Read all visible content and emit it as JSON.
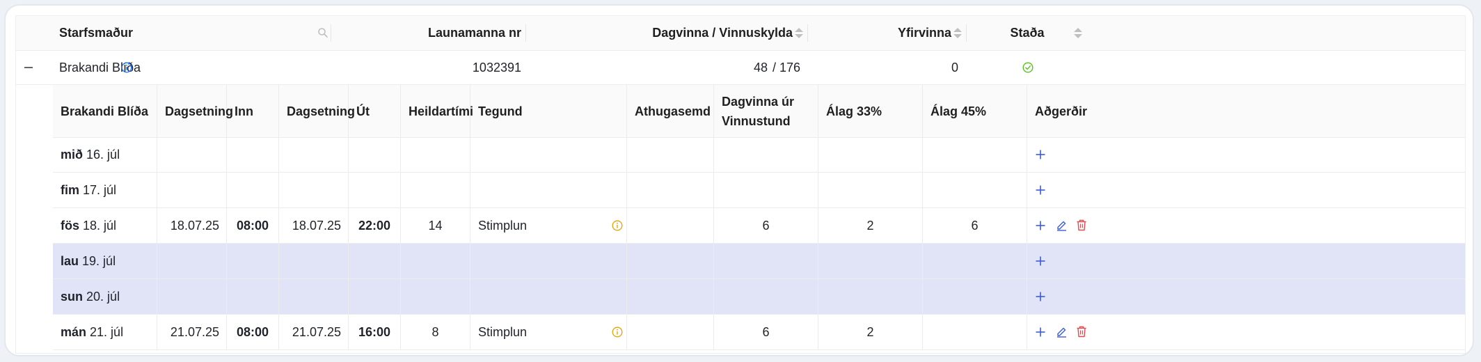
{
  "header": {
    "employee": "Starfsmaður",
    "employee_no": "Launamanna nr",
    "daywork": "Dagvinna / Vinnuskylda",
    "overtime": "Yfirvinna",
    "status": "Staða"
  },
  "employee": {
    "name": "Brakandi Blíða",
    "number": "1032391",
    "daywork": "48",
    "required": "/ 176",
    "overtime": "0"
  },
  "inner_header": {
    "name": "Brakandi Blíða",
    "date_in": "Dagsetning",
    "in": "Inn",
    "date_out": "Dagsetning",
    "out": "Út",
    "total": "Heildartími",
    "type": "Tegund",
    "comment": "Athugasemd",
    "daywork": "Dagvinna úr Vinnustund",
    "alag33": "Álag 33%",
    "alag45": "Álag 45%",
    "actions": "Aðgerðir"
  },
  "rows": [
    {
      "weekday": "mið",
      "date": "16. júl",
      "date_in": "",
      "in": "",
      "date_out": "",
      "out": "",
      "total": "",
      "type": "",
      "comment": "",
      "daywork": "",
      "alag33": "",
      "alag45": ""
    },
    {
      "weekday": "fim",
      "date": "17. júl",
      "date_in": "",
      "in": "",
      "date_out": "",
      "out": "",
      "total": "",
      "type": "",
      "comment": "",
      "daywork": "",
      "alag33": "",
      "alag45": ""
    },
    {
      "weekday": "fös",
      "date": "18. júl",
      "date_in": "18.07.25",
      "in": "08:00",
      "date_out": "18.07.25",
      "out": "22:00",
      "total": "14",
      "type": "Stimplun",
      "comment": "",
      "daywork": "6",
      "alag33": "2",
      "alag45": "6"
    },
    {
      "weekday": "lau",
      "date": "19. júl",
      "date_in": "",
      "in": "",
      "date_out": "",
      "out": "",
      "total": "",
      "type": "",
      "comment": "",
      "daywork": "",
      "alag33": "",
      "alag45": ""
    },
    {
      "weekday": "sun",
      "date": "20. júl",
      "date_in": "",
      "in": "",
      "date_out": "",
      "out": "",
      "total": "",
      "type": "",
      "comment": "",
      "daywork": "",
      "alag33": "",
      "alag45": ""
    },
    {
      "weekday": "mán",
      "date": "21. júl",
      "date_in": "21.07.25",
      "in": "08:00",
      "date_out": "21.07.25",
      "out": "16:00",
      "total": "8",
      "type": "Stimplun",
      "comment": "",
      "daywork": "6",
      "alag33": "2",
      "alag45": ""
    }
  ],
  "colors": {
    "weekend_bg": "#e1e3f6",
    "action_blue": "#3b5bdb",
    "delete_red": "#e5484d",
    "status_green": "#52c41a",
    "info_orange": "#e8a200",
    "info_blue": "#1677ff"
  },
  "icons": {
    "search": "search-icon",
    "sort": "sort-icon",
    "collapse": "minus-icon",
    "info": "info-icon",
    "status": "check-circle-icon",
    "add": "plus-icon",
    "edit": "pencil-icon",
    "delete": "trash-icon"
  }
}
